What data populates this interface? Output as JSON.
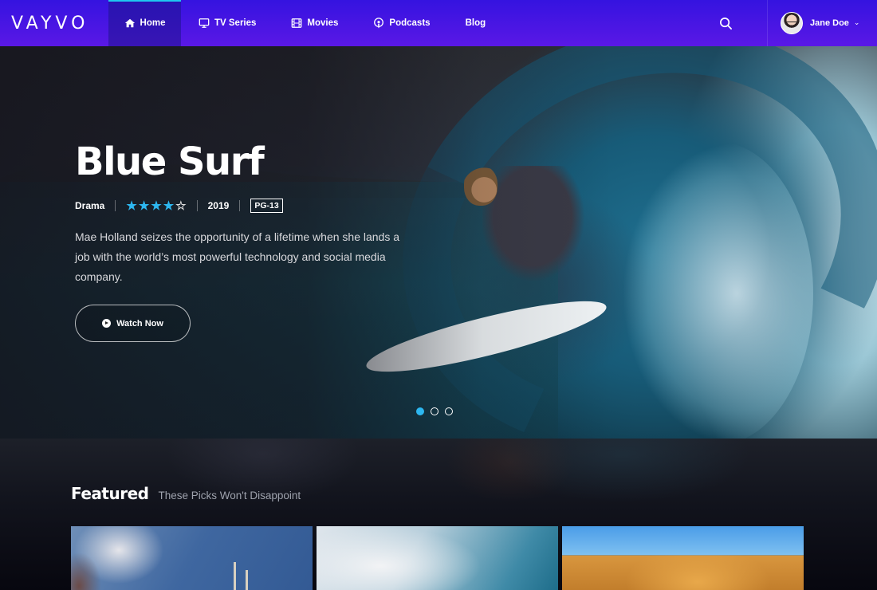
{
  "brand": {
    "logo": "VAYVO",
    "accent": "#2db7f0",
    "nav_gradient": [
      "#3513e0",
      "#5a18e6"
    ]
  },
  "nav": {
    "items": [
      {
        "label": "Home",
        "icon": "home-icon",
        "active": true
      },
      {
        "label": "TV Series",
        "icon": "tv-icon",
        "active": false
      },
      {
        "label": "Movies",
        "icon": "film-icon",
        "active": false
      },
      {
        "label": "Podcasts",
        "icon": "podcast-icon",
        "active": false
      },
      {
        "label": "Blog",
        "icon": null,
        "active": false
      }
    ],
    "search_icon": "search-icon",
    "user": {
      "name": "Jane Doe",
      "chevron": "⌄"
    }
  },
  "hero": {
    "title": "Blue Surf",
    "genre": "Drama",
    "rating_stars": 4,
    "rating_max": 5,
    "year": "2019",
    "content_rating": "PG-13",
    "description": "Mae Holland seizes the opportunity of a lifetime when she lands a job with the world’s most powerful technology and social media company.",
    "cta_label": "Watch Now",
    "slides": 3,
    "active_slide": 1
  },
  "featured": {
    "title": "Featured",
    "subtitle": "These Picks Won't Disappoint",
    "cards": [
      {
        "image": "rocket-launch"
      },
      {
        "image": "wave-closeup"
      },
      {
        "image": "desert-dunes"
      }
    ]
  }
}
